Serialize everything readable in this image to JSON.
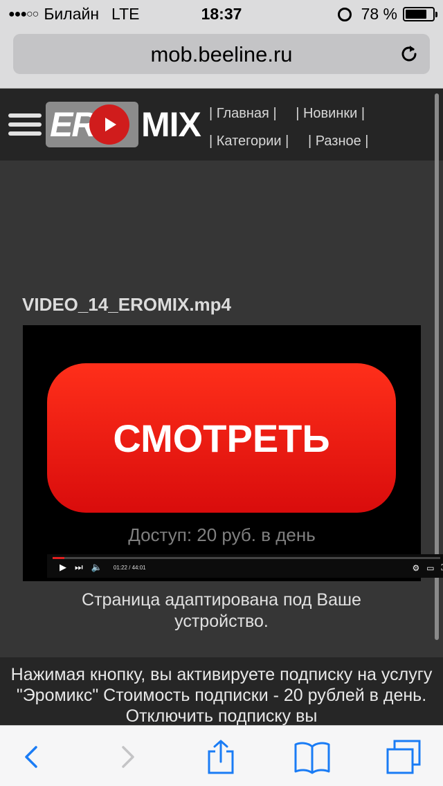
{
  "status_bar": {
    "carrier": "Билайн",
    "network": "LTE",
    "time": "18:37",
    "battery": "78 %",
    "battery_level": 0.78
  },
  "address_bar": {
    "url": "mob.beeline.ru"
  },
  "site": {
    "logo_left": "ER",
    "logo_right": "MIX",
    "nav": [
      "Главная",
      "Новинки",
      "Категории",
      "Разное"
    ]
  },
  "video": {
    "title": "VIDEO_14_EROMIX.mp4",
    "cta_label": "СМОТРЕТЬ",
    "price": "Доступ: 20 руб. в день",
    "time": "01:22 / 44:01",
    "progress": 0.03
  },
  "adapted_text": "Страница адаптирована под Ваше устройство.",
  "disclaimer": "Нажимая кнопку, вы активируете подписку на услугу \"Эромикс\" Стоимость подписки - 20 рублей в день. Отключить подписку вы",
  "colors": {
    "accent": "#e81b13",
    "ios_blue": "#1a7cf5",
    "page_bg": "#363636"
  }
}
